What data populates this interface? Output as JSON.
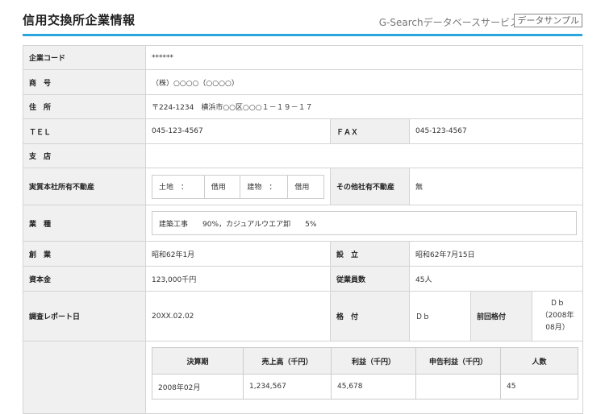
{
  "header": {
    "title": "信用交換所企業情報",
    "service": "G-Searchデータベースサービス",
    "badge": "データサンプル"
  },
  "company": {
    "code_label": "企業コード",
    "code_value": "******",
    "name_label": "商　号",
    "name_value": "（株）○○○○（○○○○）",
    "address_label": "住　所",
    "address_value": "〒224-1234　横浜市○○区○○○１－１９－１７",
    "tel_label": "ＴＥＬ",
    "tel_value": "045-123-4567",
    "fax_label": "ＦＡＸ",
    "fax_value": "045-123-4567",
    "branch_label": "支　店",
    "branch_value": "",
    "realestate_label": "実質本社所有不動産",
    "realestate": {
      "land_label": "土地　：",
      "land_value": "借用",
      "building_label": "建物　：",
      "building_value": "借用"
    },
    "other_realestate_label": "その他社有不動産",
    "other_realestate_value": "無",
    "industry_label": "業　種",
    "industry_value": "建築工事　　90%，カジュアルウエア卸　　5%",
    "founded_label": "創　業",
    "founded_value": "昭和62年1月",
    "established_label": "設　立",
    "established_value": "昭和62年7月15日",
    "capital_label": "資本金",
    "capital_value": "123,000千円",
    "employees_label": "従業員数",
    "employees_value": "45人",
    "report_date_label": "調査レポート日",
    "report_date_value": "20XX.02.02",
    "rating_label": "格　付",
    "rating_value": "Ｄｂ",
    "prev_rating_label": "前回格付",
    "prev_rating_value": "Ｄｂ",
    "prev_rating_date": "（2008年08月）"
  },
  "financials": {
    "headers": [
      "決算期",
      "売上高（千円）",
      "利益（千円）",
      "申告利益（千円）",
      "人数"
    ],
    "rows": [
      [
        "2008年02月",
        "1,234,567",
        "45,678",
        "",
        "45"
      ]
    ]
  }
}
